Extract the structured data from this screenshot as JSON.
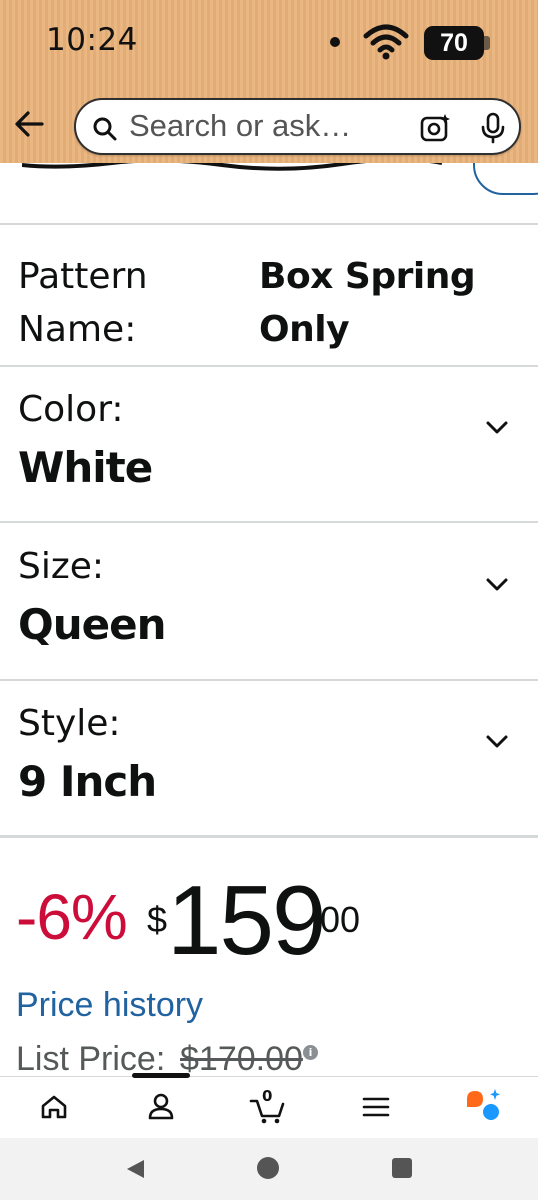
{
  "status_bar": {
    "time": "10:24",
    "battery": "70"
  },
  "header": {
    "search_placeholder": "Search or ask…",
    "background_color": "#e9b27a"
  },
  "details": {
    "pattern_label": "Pattern Name:",
    "pattern_value": "Box Spring Only"
  },
  "variations": [
    {
      "label": "Color:",
      "value": "White"
    },
    {
      "label": "Size:",
      "value": "Queen"
    },
    {
      "label": "Style:",
      "value": "9 Inch"
    }
  ],
  "price": {
    "discount": "-6%",
    "currency": "$",
    "whole": "159",
    "fraction": "00",
    "history_link": "Price history",
    "list_price_label": "List Price:",
    "list_price_value": "$170.00",
    "discount_color": "#cc0c39",
    "link_color": "#2162a1"
  },
  "bottom_nav": {
    "items": [
      "home-icon",
      "account-icon",
      "cart-icon",
      "menu-icon",
      "rufus-icon"
    ],
    "cart_count": "0"
  },
  "system_nav": {
    "items": [
      "back",
      "home",
      "recents"
    ]
  }
}
